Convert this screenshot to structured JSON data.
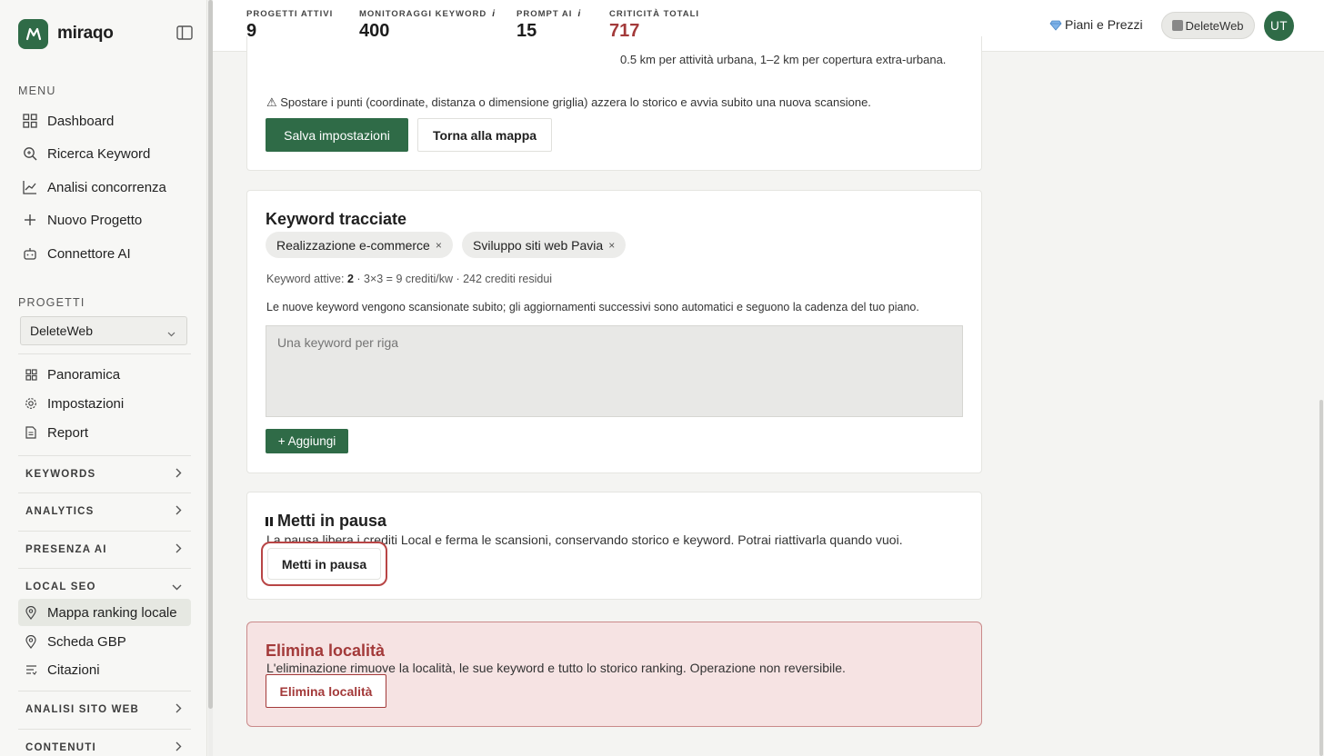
{
  "app": {
    "name": "miraqo"
  },
  "sidebar": {
    "menu_label": "MENU",
    "menu_items": [
      {
        "label": "Dashboard",
        "icon": "grid-icon"
      },
      {
        "label": "Ricerca Keyword",
        "icon": "search-icon"
      },
      {
        "label": "Analisi concorrenza",
        "icon": "chart-line-icon"
      },
      {
        "label": "Nuovo Progetto",
        "icon": "plus-icon"
      },
      {
        "label": "Connettore AI",
        "icon": "robot-icon"
      }
    ],
    "projects_label": "PROGETTI",
    "project_selected": "DeleteWeb",
    "project_items": [
      {
        "label": "Panoramica",
        "icon": "grid-icon"
      },
      {
        "label": "Impostazioni",
        "icon": "gear-icon"
      },
      {
        "label": "Report",
        "icon": "document-icon"
      }
    ],
    "groups": {
      "keywords": "KEYWORDS",
      "analytics": "ANALYTICS",
      "presenza_ai": "PRESENZA AI",
      "local_seo": "LOCAL SEO",
      "analisi_sito": "ANALISI SITO WEB",
      "contenuti": "CONTENUTI"
    },
    "local_seo_items": [
      {
        "label": "Mappa ranking locale",
        "icon": "pin-icon",
        "active": true
      },
      {
        "label": "Scheda GBP",
        "icon": "pin-icon",
        "active": false
      },
      {
        "label": "Citazioni",
        "icon": "list-icon",
        "active": false
      }
    ]
  },
  "topbar": {
    "stats": [
      {
        "label": "PROGETTI ATTIVI",
        "value": "9",
        "info": ""
      },
      {
        "label": "MONITORAGGI KEYWORD",
        "value": "400",
        "info": "i"
      },
      {
        "label": "PROMPT AI",
        "value": "15",
        "info": "i"
      },
      {
        "label": "CRITICITÀ TOTALI",
        "value": "717",
        "info": ""
      }
    ],
    "plans_label": "Piani e Prezzi",
    "workspace_label": "DeleteWeb",
    "avatar_initials": "UT"
  },
  "settings_card": {
    "radius_note": "0.5 km per attività urbana, 1–2 km per copertura extra-urbana.",
    "warning": "⚠ Spostare i punti (coordinate, distanza o dimensione griglia) azzera lo storico e avvia subito una nuova scansione.",
    "save_button": "Salva impostazioni",
    "back_button": "Torna alla mappa"
  },
  "keywords_card": {
    "title": "Keyword tracciate",
    "chips": [
      "Realizzazione e-commerce",
      "Sviluppo siti web Pavia"
    ],
    "chip_remove": "×",
    "active_prefix": "Keyword attive: ",
    "active_count": "2",
    "active_suffix": " · 3×3 = 9 crediti/kw · 242 crediti residui",
    "info_text": "Le nuove keyword vengono scansionate subito; gli aggiornamenti successivi sono automatici e seguono la cadenza del tuo piano.",
    "textarea_placeholder": "Una keyword per riga",
    "add_button": "+ Aggiungi"
  },
  "pause_card": {
    "title": "Metti in pausa",
    "description": "La pausa libera i crediti Local e ferma le scansioni, conservando storico e keyword. Potrai riattivarla quando vuoi.",
    "button": "Metti in pausa"
  },
  "delete_card": {
    "title": "Elimina località",
    "description": "L'eliminazione rimuove la località, le sue keyword e tutto lo storico ranking. Operazione non reversibile.",
    "button": "Elimina località"
  },
  "colors": {
    "brand_green": "#2f6b47",
    "danger_red": "#a33a3a",
    "danger_bg": "#f6e3e3"
  }
}
